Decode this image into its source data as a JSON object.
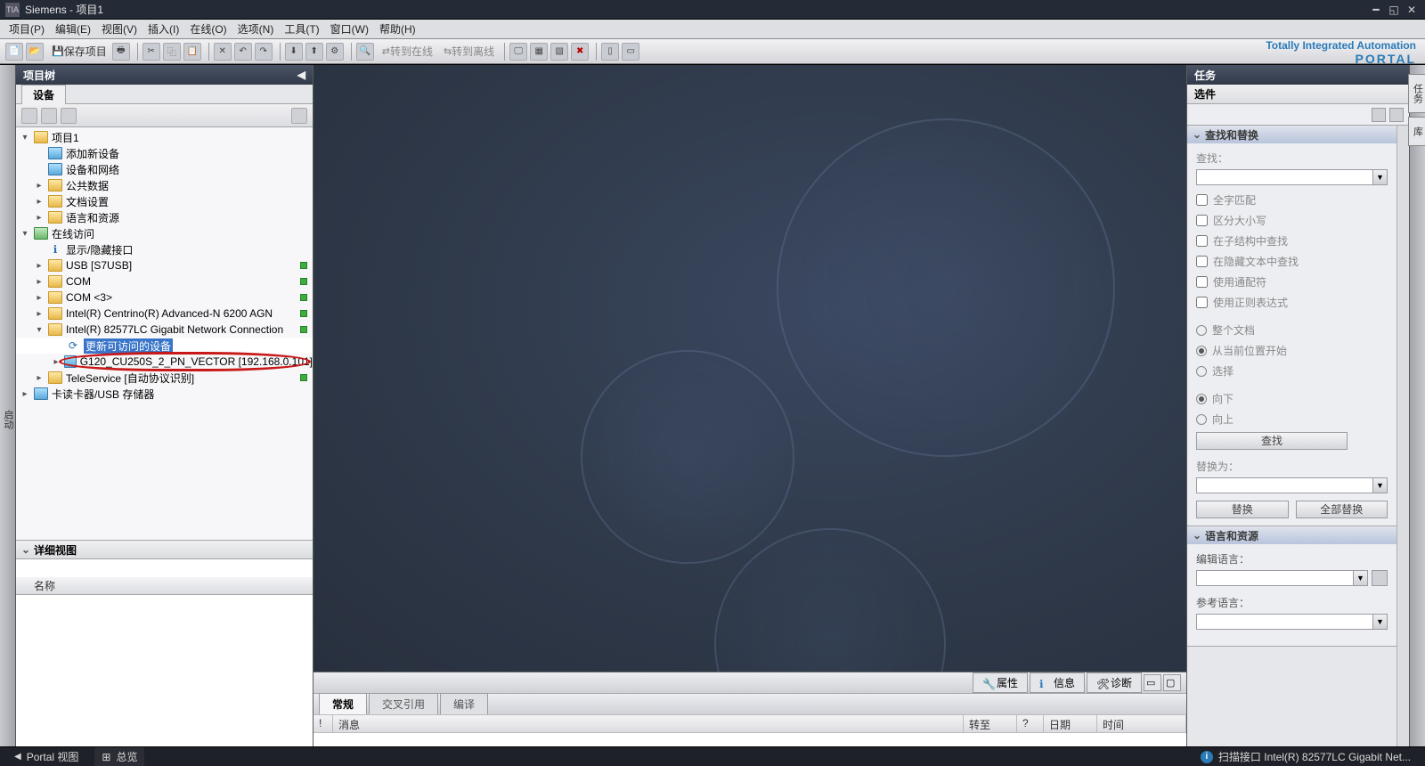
{
  "title_bar": {
    "app": "Siemens",
    "sep": " - ",
    "project": "项目1"
  },
  "menu": [
    "项目(P)",
    "编辑(E)",
    "视图(V)",
    "插入(I)",
    "在线(O)",
    "选项(N)",
    "工具(T)",
    "窗口(W)",
    "帮助(H)"
  ],
  "toolbar": {
    "save_label": "保存项目",
    "go_online": "转到在线",
    "go_offline": "转到离线"
  },
  "brand": {
    "line1": "Totally Integrated Automation",
    "line2": "PORTAL"
  },
  "side_left_tab": "启动",
  "side_right_tabs": [
    "任务",
    "库"
  ],
  "project_tree": {
    "header": "项目树",
    "device_tab": "设备",
    "nodes": {
      "root": "项目1",
      "add_device": "添加新设备",
      "devices_networks": "设备和网络",
      "common_data": "公共数据",
      "doc_settings": "文档设置",
      "lang_resources": "语言和资源",
      "online_access": "在线访问",
      "show_hidden": "显示/隐藏接口",
      "usb": "USB [S7USB]",
      "com": "COM",
      "com3": "COM <3>",
      "intel_wifi": "Intel(R) Centrino(R) Advanced-N 6200 AGN",
      "intel_eth": "Intel(R) 82577LC Gigabit Network Connection",
      "refresh": "更新可访问的设备",
      "g120": "G120_CU250S_2_PN_VECTOR [192.168.0.101]",
      "teleservice": "TeleService [自动协议识别]",
      "card_reader": "卡读卡器/USB 存储器"
    }
  },
  "detail": {
    "header": "详细视图",
    "col_name": "名称"
  },
  "info_panel": {
    "props": "属性",
    "info": "信息",
    "diag": "诊断",
    "tabs": {
      "general": "常规",
      "xref": "交叉引用",
      "compile": "编译"
    },
    "cols": {
      "msg": "消息",
      "goto": "转至",
      "q": "?",
      "date": "日期",
      "time": "时间"
    }
  },
  "tasks": {
    "header": "任务",
    "options": "选件",
    "find_replace": "查找和替换",
    "find_label": "查找：",
    "whole_word": "全字匹配",
    "match_case": "区分大小写",
    "in_substructure": "在子结构中查找",
    "in_hidden": "在隐藏文本中查找",
    "wildcards": "使用通配符",
    "regex": "使用正则表达式",
    "whole_doc": "整个文档",
    "from_current": "从当前位置开始",
    "selection": "选择",
    "down": "向下",
    "up": "向上",
    "find_btn": "查找",
    "replace_label": "替换为：",
    "replace_btn": "替换",
    "replace_all_btn": "全部替换",
    "lang_section": "语言和资源",
    "edit_lang": "编辑语言：",
    "ref_lang": "参考语言："
  },
  "status": {
    "portal_view": "Portal 视图",
    "overview": "总览",
    "scan": "扫描接口 Intel(R) 82577LC Gigabit Net..."
  }
}
